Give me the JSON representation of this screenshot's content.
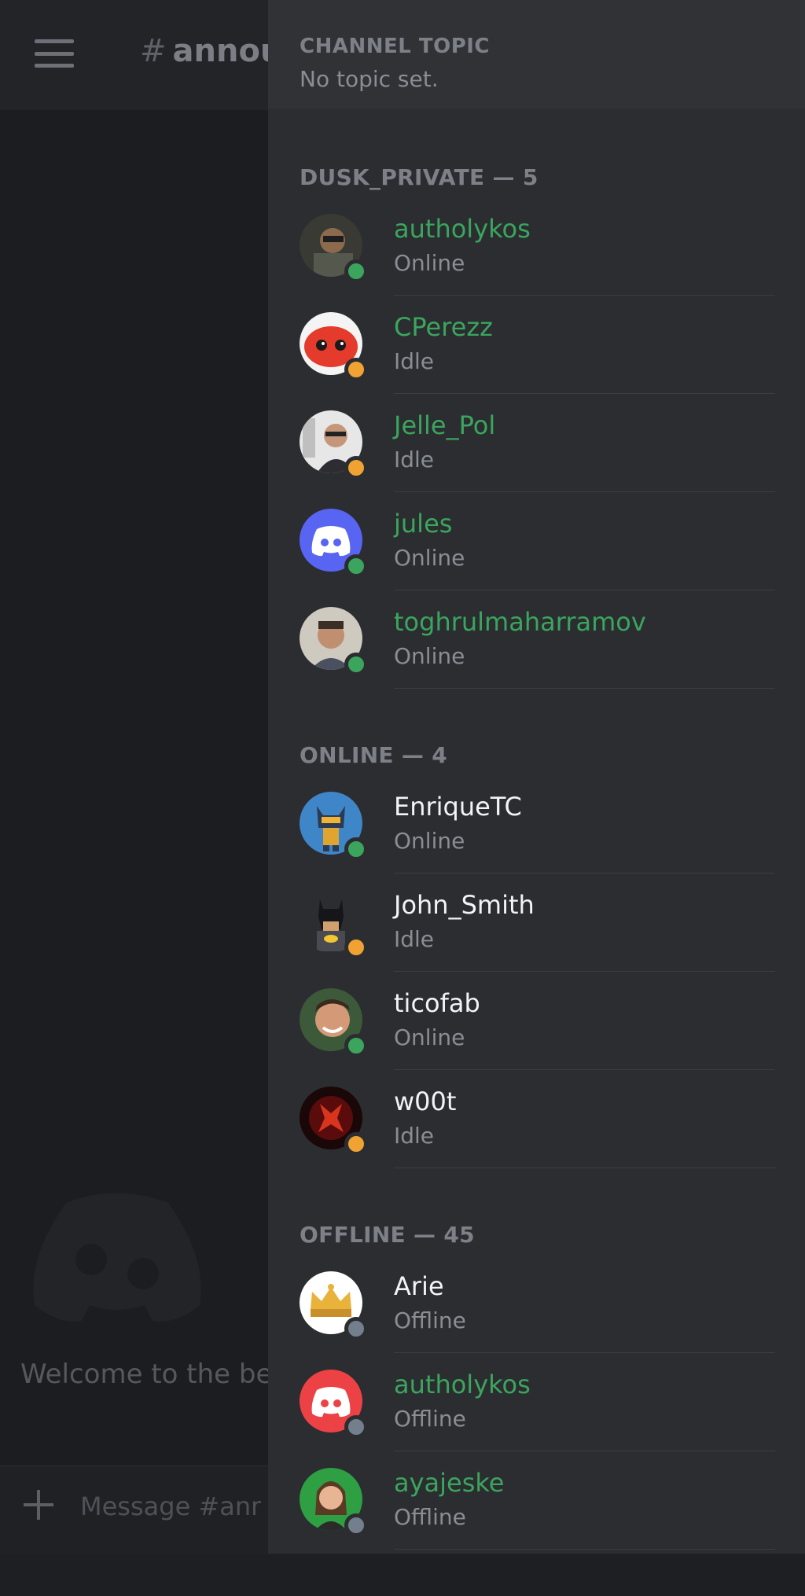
{
  "colors": {
    "role_green": "#3ba55d",
    "default_name": "#f2f3f5",
    "online": "#3ba55d",
    "idle": "#f0a232",
    "offline": "#747f8d"
  },
  "chat": {
    "channel_hash": "#",
    "channel_name": "annou",
    "welcome_text": "Welcome to the begi",
    "composer_placeholder": "Message #annou"
  },
  "topic": {
    "label": "CHANNEL TOPIC",
    "value": "No topic set."
  },
  "sections": [
    {
      "title": "DUSK_PRIVATE — 5",
      "members": [
        {
          "name": "autholykos",
          "status": "Online",
          "status_type": "online",
          "name_color": "green",
          "avatar": "photo-dark"
        },
        {
          "name": "CPerezz",
          "status": "Idle",
          "status_type": "idle",
          "name_color": "green",
          "avatar": "red-crab"
        },
        {
          "name": "Jelle_Pol",
          "status": "Idle",
          "status_type": "idle",
          "name_color": "green",
          "avatar": "photo-light"
        },
        {
          "name": "jules",
          "status": "Online",
          "status_type": "online",
          "name_color": "green",
          "avatar": "discord-blurple"
        },
        {
          "name": "toghrulmaharramov",
          "status": "Online",
          "status_type": "online",
          "name_color": "green",
          "avatar": "photo-face"
        }
      ]
    },
    {
      "title": "ONLINE — 4",
      "members": [
        {
          "name": "EnriqueTC",
          "status": "Online",
          "status_type": "online",
          "name_color": "white",
          "avatar": "robot-blue"
        },
        {
          "name": "John_Smith",
          "status": "Idle",
          "status_type": "idle",
          "name_color": "white",
          "avatar": "batman"
        },
        {
          "name": "ticofab",
          "status": "Online",
          "status_type": "online",
          "name_color": "white",
          "avatar": "photo-smile"
        },
        {
          "name": "w00t",
          "status": "Idle",
          "status_type": "idle",
          "name_color": "white",
          "avatar": "red-emblem"
        }
      ]
    },
    {
      "title": "OFFLINE — 45",
      "members": [
        {
          "name": "Arie",
          "status": "Offline",
          "status_type": "offline",
          "name_color": "white",
          "avatar": "crown"
        },
        {
          "name": "autholykos",
          "status": "Offline",
          "status_type": "offline",
          "name_color": "green",
          "avatar": "discord-red"
        },
        {
          "name": "ayajeske",
          "status": "Offline",
          "status_type": "offline",
          "name_color": "green",
          "avatar": "photo-green"
        }
      ]
    }
  ]
}
